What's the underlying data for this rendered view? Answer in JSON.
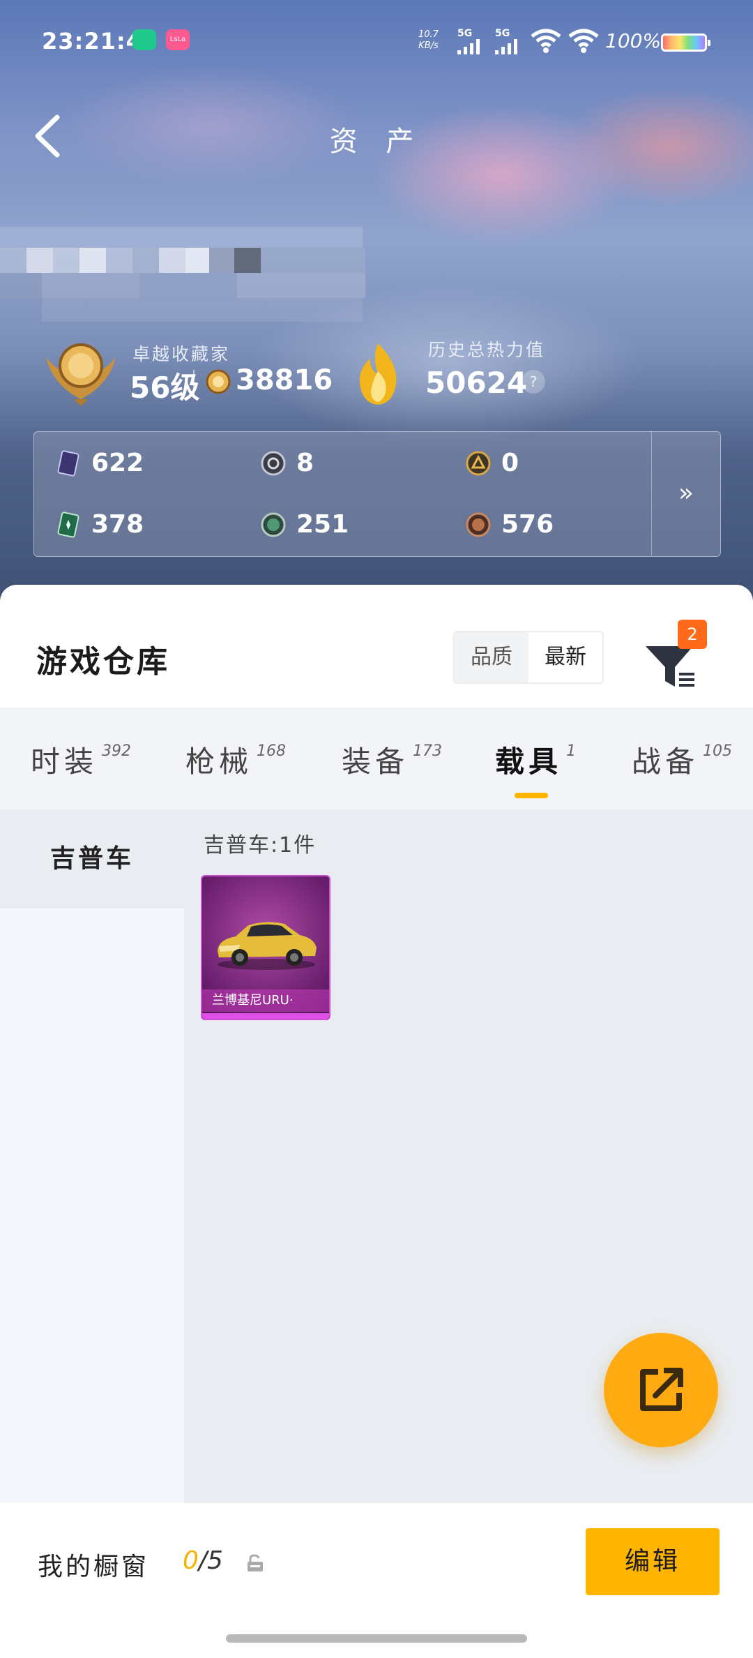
{
  "status_bar": {
    "time": "23:21:45",
    "net_speed_value": "10.7",
    "net_speed_unit": "KB/s",
    "sim1_label": "5G",
    "sim2_label": "5G",
    "battery": "100%",
    "app_badge_label": "LsLa"
  },
  "header": {
    "title": "资 产",
    "back_icon": "chevron-left-icon"
  },
  "profile": {
    "collector_label": "卓越收藏家",
    "level": "56级",
    "coin_value": "38816",
    "heat_label": "历史总热力值",
    "heat_value": "50624",
    "help": "?"
  },
  "stats": [
    {
      "icon": "card-purple-icon",
      "value": "622"
    },
    {
      "icon": "silver-emblem-icon",
      "value": "8"
    },
    {
      "icon": "gold-emblem-icon",
      "value": "0"
    },
    {
      "icon": "card-green-icon",
      "value": "378"
    },
    {
      "icon": "green-orb-icon",
      "value": "251"
    },
    {
      "icon": "bronze-medal-icon",
      "value": "576"
    }
  ],
  "stats_more": "»",
  "warehouse": {
    "title": "游戏仓库",
    "sort_options": [
      "品质",
      "最新"
    ],
    "sort_selected": "最新",
    "filter_count": "2"
  },
  "tabs": [
    {
      "label": "时装",
      "count": "392"
    },
    {
      "label": "枪械",
      "count": "168"
    },
    {
      "label": "装备",
      "count": "173"
    },
    {
      "label": "载具",
      "count": "1",
      "active": true
    },
    {
      "label": "战备",
      "count": "105"
    }
  ],
  "categories": [
    {
      "label": "吉普车",
      "active": true
    }
  ],
  "section": {
    "label": "吉普车:1件"
  },
  "items": [
    {
      "name": "兰博基尼URU·",
      "rarity_color": "#e04fe6"
    }
  ],
  "bottom": {
    "showcase_label": "我的橱窗",
    "showcase_current": "0",
    "showcase_total": "/5",
    "edit_label": "编辑"
  },
  "colors": {
    "accent": "#ffb400",
    "badge": "#ff6a1a",
    "item_rarity": "#c84fd0"
  }
}
